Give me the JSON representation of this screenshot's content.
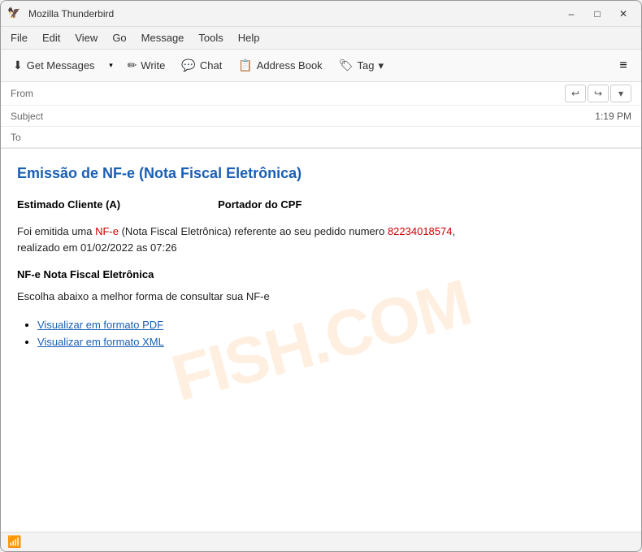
{
  "window": {
    "title": "Mozilla Thunderbird",
    "icon": "🦅"
  },
  "titlebar": {
    "minimize": "–",
    "maximize": "□",
    "close": "✕"
  },
  "menubar": {
    "items": [
      "File",
      "Edit",
      "View",
      "Go",
      "Message",
      "Tools",
      "Help"
    ]
  },
  "toolbar": {
    "get_messages": "Get Messages",
    "write": "Write",
    "chat": "Chat",
    "address_book": "Address Book",
    "tag": "Tag",
    "menu_icon": "≡",
    "dropdown_arrow": "▾"
  },
  "email_header": {
    "from_label": "From",
    "subject_label": "Subject",
    "to_label": "To",
    "time": "1:19 PM",
    "reply_icon": "↩",
    "forward_icon": "↪",
    "more_icon": "▾"
  },
  "email": {
    "title": "Emissão de NF-e (Nota Fiscal Eletrônica)",
    "greeting_left": "Estimado Cliente (A)",
    "greeting_right": "Portador do CPF",
    "paragraph_before_nfe": "Foi emitida uma ",
    "nfe_text": "NF-e",
    "paragraph_after_nfe": " (Nota Fiscal Eletrônica) referente ao seu pedido numero ",
    "order_number": "82234018574",
    "paragraph_end": ",",
    "paragraph_line2": "realizado em 01/02/2022 as 07:26",
    "section_title": "NF-e Nota Fiscal Eletrônica",
    "instruction": "Escolha abaixo a melhor forma de consultar sua NF-e",
    "links": [
      "Visualizar em formato PDF",
      "Visualizar em formato XML"
    ]
  },
  "watermark": "FISH.COM",
  "statusbar": {
    "wifi_icon": "📶"
  }
}
